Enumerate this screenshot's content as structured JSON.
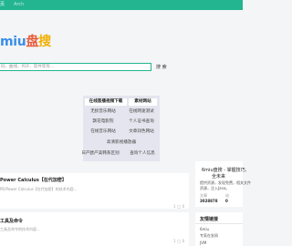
{
  "topbar": {
    "items": [
      "页",
      "Arch"
    ]
  },
  "logo": {
    "part1": "miu",
    "part2": "盘",
    "part3": "搜"
  },
  "search": {
    "placeholder": "码、曲线、PDF、软件等等...",
    "button_label": "搜 索"
  },
  "quick_links": {
    "rows": [
      [
        "在线直播视频下载",
        "素材网站"
      ],
      [
        "无损音乐网站",
        "在线网速测试"
      ],
      [
        "飘花电影院",
        "个人证书查询"
      ],
      [
        "在线音乐网站",
        "文章润色网站"
      ],
      [
        "高清影视播放器"
      ],
      [
        "日产欧产美韩系区别",
        "查询个人信息"
      ]
    ]
  },
  "posts": [
    {
      "title": "Power Calculus【在代加密】",
      "subtitle": "PE(Power Calculus【在代加密】的技术内容...",
      "meta_left": "",
      "meta_right": "1 ◯ 0"
    },
    {
      "title": "工具及命令",
      "subtitle": "工具及命令的技术内容...",
      "meta_right": "1 ◯ 0"
    }
  ],
  "sidebar": {
    "profile": {
      "title_line1": "6miu盘搜 - 掌握技巧,",
      "title_line2": "全未来",
      "desc_line1": "提供资源，发现免费，相关文件",
      "desc_line2": "资源，注入Java。",
      "stat1_label": "文章",
      "stat1_value": "3028878",
      "stat2_label": "站",
      "stat2_value": "0"
    },
    "section_title": "友情链接",
    "links": [
      "6miu",
      "专家在发网",
      "JVM"
    ]
  },
  "colors": {
    "accent": "#22b58f",
    "logo_blue": "#3a8ee6",
    "logo_red": "#e65b3a",
    "logo_yellow": "#f0b000"
  }
}
